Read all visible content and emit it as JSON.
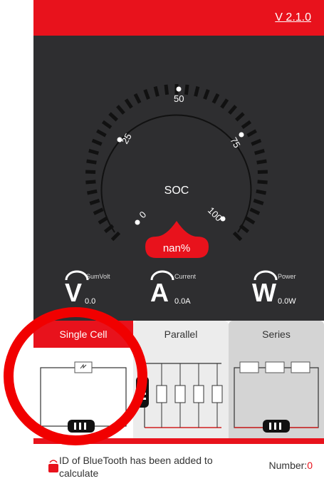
{
  "header": {
    "version": "V 2.1.0"
  },
  "gauge": {
    "center_label": "SOC",
    "tick_labels": [
      "0",
      "25",
      "50",
      "75",
      "100"
    ],
    "value_text": "nan%"
  },
  "meters": [
    {
      "letter": "V",
      "label": "SumVolt",
      "value": "0.0"
    },
    {
      "letter": "A",
      "label": "Current",
      "value": "0.0A"
    },
    {
      "letter": "W",
      "label": "Power",
      "value": "0.0W"
    }
  ],
  "tabs": [
    {
      "label": "Single Cell",
      "selected": true
    },
    {
      "label": "Parallel",
      "selected": false
    },
    {
      "label": "Series",
      "selected": false
    }
  ],
  "footer": {
    "message": "ID of BlueTooth has been added to calculate",
    "count_label": "Number:",
    "count_value": "0"
  },
  "colors": {
    "accent": "#e8121c",
    "panel": "#2e2e30",
    "annotation": "#f10000"
  }
}
